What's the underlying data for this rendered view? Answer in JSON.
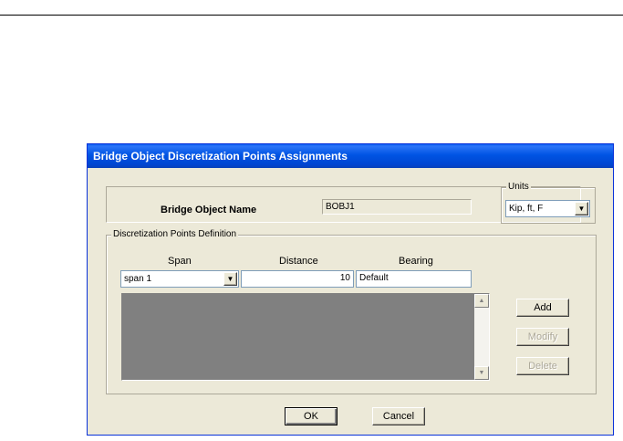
{
  "dialog": {
    "title": "Bridge Object Discretization Points Assignments"
  },
  "bridge_object": {
    "label": "Bridge Object Name",
    "value": "BOBJ1"
  },
  "units": {
    "group_label": "Units",
    "selected": "Kip, ft, F"
  },
  "definition": {
    "group_label": "Discretization Points Definition",
    "headers": {
      "span": "Span",
      "distance": "Distance",
      "bearing": "Bearing"
    },
    "span_value": "span 1",
    "distance_value": "10",
    "bearing_value": "Default"
  },
  "buttons": {
    "add": "Add",
    "modify": "Modify",
    "delete": "Delete",
    "ok": "OK",
    "cancel": "Cancel"
  },
  "icons": {
    "dropdown": "▼",
    "scroll_up": "▲",
    "scroll_down": "▼"
  }
}
